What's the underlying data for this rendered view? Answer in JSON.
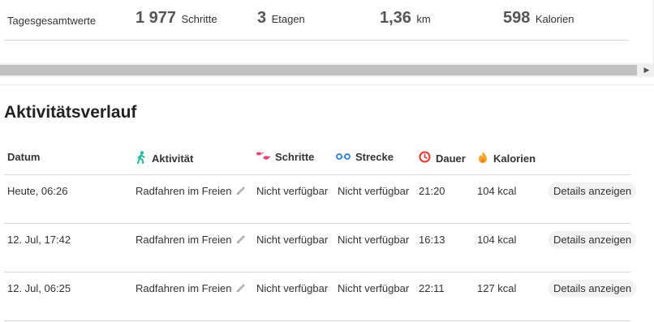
{
  "summary": {
    "label": "Tagesgesamtwerte",
    "metrics": [
      {
        "value": "1 977",
        "unit": "Schritte"
      },
      {
        "value": "3",
        "unit": "Etagen"
      },
      {
        "value": "1,36",
        "unit": "km"
      },
      {
        "value": "598",
        "unit": "Kalorien"
      }
    ]
  },
  "history": {
    "title": "Aktivitätsverlauf",
    "columns": {
      "date": "Datum",
      "activity": "Aktivität",
      "steps": "Schritte",
      "distance": "Strecke",
      "duration": "Dauer",
      "calories": "Kalorien"
    },
    "icons": {
      "activity": "walking-person-icon",
      "steps": "footprints-icon",
      "distance": "route-icon",
      "duration": "clock-icon",
      "calories": "flame-icon",
      "edit": "pencil-icon"
    },
    "colors": {
      "activity": "#1fb8a6",
      "steps": "#e0457b",
      "distance": "#2d7fd1",
      "duration": "#e8382c",
      "calories": "#f5a623"
    },
    "rows": [
      {
        "date": "Heute, 06:26",
        "activity": "Radfahren im Freien",
        "steps": "Nicht verfügbar",
        "distance": "Nicht verfügbar",
        "duration": "21:20",
        "calories": "104 kcal",
        "details": "Details anzeigen"
      },
      {
        "date": "12. Jul, 17:42",
        "activity": "Radfahren im Freien",
        "steps": "Nicht verfügbar",
        "distance": "Nicht verfügbar",
        "duration": "16:13",
        "calories": "104 kcal",
        "details": "Details anzeigen"
      },
      {
        "date": "12. Jul, 06:25",
        "activity": "Radfahren im Freien",
        "steps": "Nicht verfügbar",
        "distance": "Nicht verfügbar",
        "duration": "22:11",
        "calories": "127 kcal",
        "details": "Details anzeigen"
      }
    ]
  }
}
